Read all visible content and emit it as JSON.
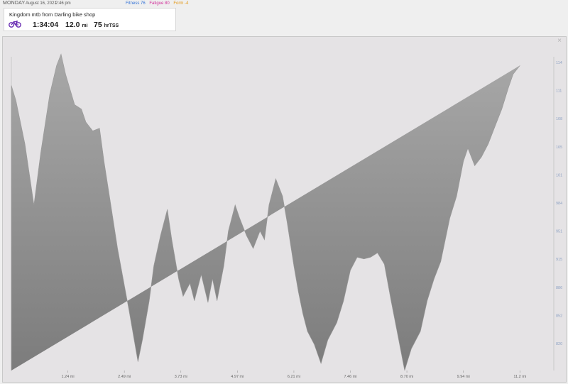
{
  "header": {
    "day": "MONDAY",
    "date": "August 16, 2021",
    "time": "2:46 pm",
    "fitness": "Fitness 76",
    "fatigue": "Fatigue 80",
    "form": "Form -4"
  },
  "activity": {
    "title": "Kingdom mtb from Darling bike shop",
    "icon": "bicycle-icon",
    "duration": "1:34:04",
    "distance": "12.0",
    "distance_unit": "mi",
    "tss": "75",
    "tss_unit": "hrTSS"
  },
  "colors": {
    "fitness": "#2f6fd6",
    "fatigue": "#d0309a",
    "form": "#e39a1b",
    "bike_icon": "#6a2fb3",
    "area_fill": "#8a8a8a"
  },
  "chart_data": {
    "type": "area",
    "x_tick_labels": [
      "1.24 mi",
      "2.49 mi",
      "3.73 mi",
      "4.97 mi",
      "6.21 mi",
      "7.46 mi",
      "8.70 mi",
      "9.94 mi",
      "11.2 mi"
    ],
    "y_tick_labels": [
      "114",
      "111",
      "108",
      "105",
      "101",
      "984",
      "951",
      "915",
      "886",
      "852",
      "820"
    ],
    "xlim": [
      0,
      12.0
    ],
    "ylim": [
      800,
      1160
    ],
    "x": [
      0.0,
      0.1,
      0.3,
      0.5,
      0.65,
      0.85,
      1.0,
      1.1,
      1.2,
      1.4,
      1.55,
      1.65,
      1.8,
      1.95,
      2.05,
      2.2,
      2.35,
      2.6,
      2.8,
      2.9,
      3.05,
      3.15,
      3.3,
      3.45,
      3.55,
      3.7,
      3.8,
      3.95,
      4.05,
      4.2,
      4.35,
      4.45,
      4.55,
      4.7,
      4.8,
      4.95,
      5.05,
      5.2,
      5.35,
      5.5,
      5.6,
      5.7,
      5.85,
      6.0,
      6.1,
      6.25,
      6.35,
      6.45,
      6.55,
      6.7,
      6.85,
      7.0,
      7.2,
      7.35,
      7.5,
      7.65,
      7.8,
      7.95,
      8.1,
      8.25,
      8.4,
      8.55,
      8.7,
      8.85,
      9.05,
      9.2,
      9.35,
      9.5,
      9.6,
      9.7,
      9.85,
      10.0,
      10.1,
      10.25,
      10.4,
      10.55,
      10.7,
      10.85,
      11.0,
      11.1,
      11.25,
      11.4,
      11.55,
      11.7,
      11.85,
      12.0
    ],
    "y": [
      1127,
      1110,
      1060,
      990,
      1050,
      1117,
      1150,
      1163,
      1140,
      1105,
      1100,
      1085,
      1075,
      1078,
      1040,
      990,
      940,
      870,
      810,
      835,
      880,
      920,
      955,
      985,
      950,
      905,
      885,
      900,
      880,
      910,
      878,
      905,
      880,
      920,
      960,
      990,
      975,
      955,
      940,
      960,
      950,
      990,
      1020,
      1000,
      970,
      920,
      890,
      865,
      845,
      830,
      808,
      835,
      855,
      880,
      915,
      930,
      928,
      930,
      935,
      922,
      880,
      840,
      800,
      825,
      845,
      880,
      905,
      925,
      950,
      975,
      1000,
      1040,
      1055,
      1035,
      1045,
      1060,
      1080,
      1100,
      1125,
      1140,
      1150
    ]
  }
}
